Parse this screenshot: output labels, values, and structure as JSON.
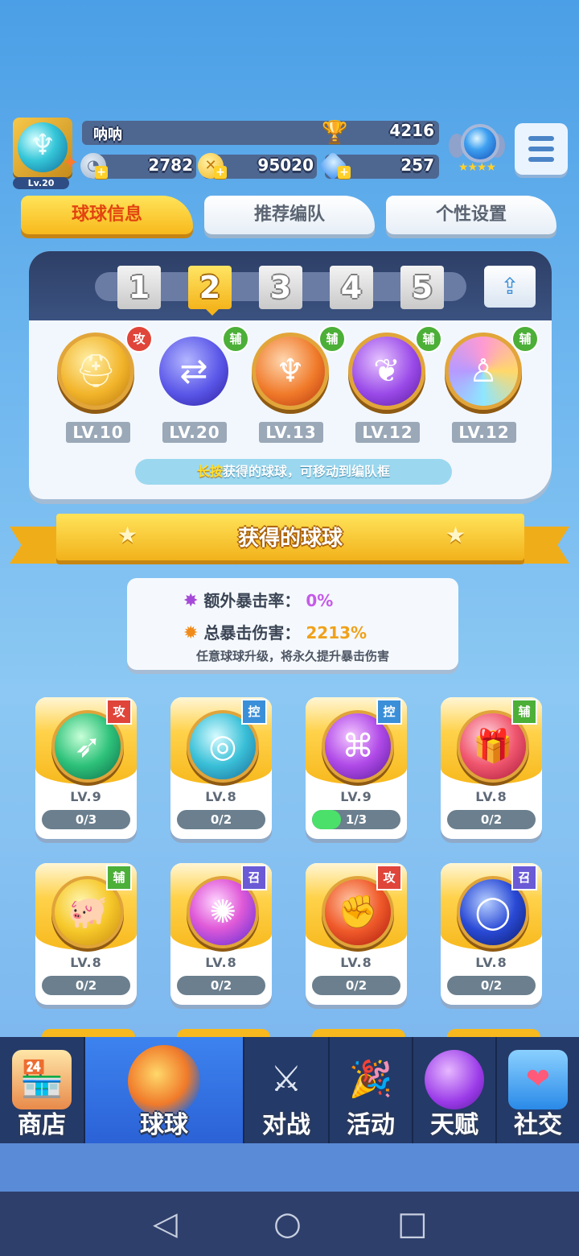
{
  "player": {
    "name": "呐呐",
    "level": "Lv.20",
    "trophies": "4216",
    "stamina": "2782",
    "coins": "95020",
    "gems": "257"
  },
  "tabs": [
    "球球信息",
    "推荐编队",
    "个性设置"
  ],
  "team": {
    "slots": [
      "1",
      "2",
      "3",
      "4",
      "5"
    ],
    "active_slot": "2",
    "members": [
      {
        "level": "LV.10",
        "role": "攻",
        "icon": "helmet-icon"
      },
      {
        "level": "LV.20",
        "role": "辅",
        "icon": "swap-arrows-icon"
      },
      {
        "level": "LV.13",
        "role": "辅",
        "icon": "wings-icon"
      },
      {
        "level": "LV.12",
        "role": "辅",
        "icon": "leaf-icon"
      },
      {
        "level": "LV.12",
        "role": "辅",
        "icon": "people-icon"
      }
    ],
    "hint_em": "长按",
    "hint_rest": "获得的球球，可移动到编队框"
  },
  "section_title": "获得的球球",
  "crit": {
    "extra_label": "额外暴击率：",
    "extra_value": "0%",
    "total_label": "总暴击伤害：",
    "total_value": "2213%",
    "note": "任意球球升级，将永久提升暴击伤害"
  },
  "cards": [
    {
      "level": "LV.9",
      "progress": "0/3",
      "fill": 0,
      "role": "攻",
      "icon": "bow-icon"
    },
    {
      "level": "LV.8",
      "progress": "0/2",
      "fill": 0,
      "role": "控",
      "icon": "swirl-icon"
    },
    {
      "level": "LV.9",
      "progress": "1/3",
      "fill": 0.33,
      "role": "控",
      "icon": "pillar-icon"
    },
    {
      "level": "LV.8",
      "progress": "0/2",
      "fill": 0,
      "role": "辅",
      "icon": "gift-icon"
    },
    {
      "level": "LV.8",
      "progress": "0/2",
      "fill": 0,
      "role": "辅",
      "icon": "piggy-bank-icon"
    },
    {
      "level": "LV.8",
      "progress": "0/2",
      "fill": 0,
      "role": "召",
      "icon": "phoenix-icon"
    },
    {
      "level": "LV.8",
      "progress": "0/2",
      "fill": 0,
      "role": "攻",
      "icon": "fist-icon"
    },
    {
      "level": "LV.8",
      "progress": "0/2",
      "fill": 0,
      "role": "召",
      "icon": "portal-icon"
    }
  ],
  "nav": [
    {
      "label": "商店",
      "icon": "shop-icon"
    },
    {
      "label": "球球",
      "icon": "orbs-icon"
    },
    {
      "label": "对战",
      "icon": "crossed-swords-icon"
    },
    {
      "label": "活动",
      "icon": "party-popper-icon"
    },
    {
      "label": "天赋",
      "icon": "planet-icon"
    },
    {
      "label": "社交",
      "icon": "chat-heart-icon"
    }
  ],
  "colors": {
    "accent_yellow": "#f8b91c",
    "attack_tag": "#e0453a",
    "support_tag": "#4caf38",
    "control_tag": "#3a8fd8",
    "summon_tag": "#6a5ad6",
    "nav_bg": "#243a68"
  }
}
